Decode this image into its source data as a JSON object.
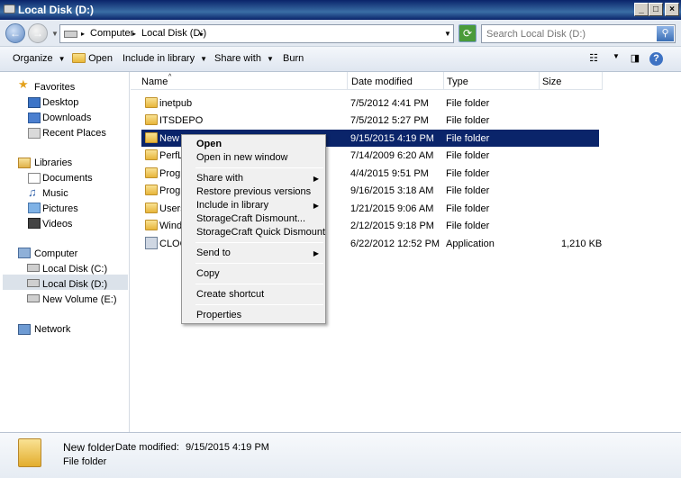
{
  "window": {
    "title": "Local Disk (D:)"
  },
  "address": {
    "crumbs": [
      "Computer",
      "Local Disk (D:)"
    ],
    "search_placeholder": "Search Local Disk (D:)"
  },
  "toolbar": {
    "organize": "Organize",
    "open": "Open",
    "include_in_library": "Include in library",
    "share_with": "Share with",
    "burn": "Burn"
  },
  "sidebar": {
    "favorites": "Favorites",
    "desktop": "Desktop",
    "downloads": "Downloads",
    "recent_places": "Recent Places",
    "libraries": "Libraries",
    "documents": "Documents",
    "music": "Music",
    "pictures": "Pictures",
    "videos": "Videos",
    "computer": "Computer",
    "local_disk_c": "Local Disk (C:)",
    "local_disk_d": "Local Disk (D:)",
    "new_volume_e": "New Volume (E:)",
    "network": "Network"
  },
  "columns": {
    "name": "Name",
    "date_modified": "Date modified",
    "type": "Type",
    "size": "Size"
  },
  "files": [
    {
      "name": "inetpub",
      "date": "7/5/2012 4:41 PM",
      "type": "File folder",
      "size": ""
    },
    {
      "name": "ITSDEPO",
      "date": "7/5/2012 5:27 PM",
      "type": "File folder",
      "size": ""
    },
    {
      "name": "New f",
      "date": "9/15/2015 4:19 PM",
      "type": "File folder",
      "size": ""
    },
    {
      "name": "PerfL",
      "date": "7/14/2009 6:20 AM",
      "type": "File folder",
      "size": ""
    },
    {
      "name": "Progr",
      "date": "4/4/2015 9:51 PM",
      "type": "File folder",
      "size": ""
    },
    {
      "name": "Progr",
      "date": "9/16/2015 3:18 AM",
      "type": "File folder",
      "size": ""
    },
    {
      "name": "Users",
      "date": "1/21/2015 9:06 AM",
      "type": "File folder",
      "size": ""
    },
    {
      "name": "Windo",
      "date": "2/12/2015 9:18 PM",
      "type": "File folder",
      "size": ""
    },
    {
      "name": "CLOG",
      "date": "6/22/2012 12:52 PM",
      "type": "Application",
      "size": "1,210 KB"
    }
  ],
  "context_menu": {
    "open": "Open",
    "open_new_window": "Open in new window",
    "share_with": "Share with",
    "restore_previous_versions": "Restore previous versions",
    "include_in_library": "Include in library",
    "storagecraft_dismount": "StorageCraft Dismount...",
    "storagecraft_quick_dismount": "StorageCraft Quick Dismount",
    "send_to": "Send to",
    "copy": "Copy",
    "create_shortcut": "Create shortcut",
    "properties": "Properties"
  },
  "details": {
    "name": "New folder",
    "date_label": "Date modified:",
    "date_value": "9/15/2015 4:19 PM",
    "type": "File folder"
  }
}
